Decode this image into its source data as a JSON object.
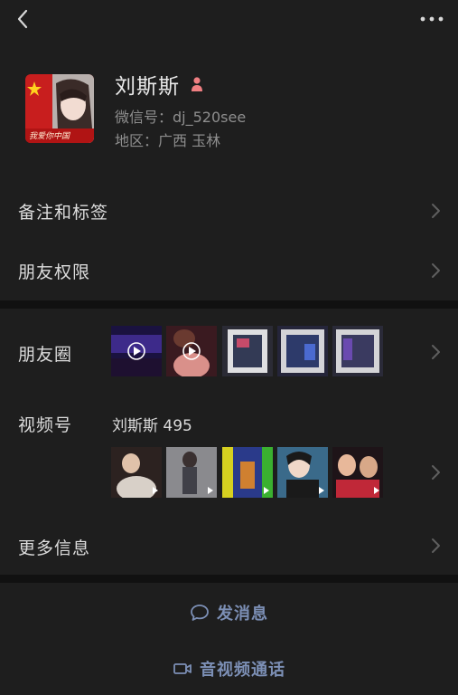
{
  "profile": {
    "name": "刘斯斯",
    "wechat_id": "微信号：dj_520see",
    "region": "地区：广西 玉林",
    "avatar_caption": "我爱你中国"
  },
  "menu": {
    "remark_tags": "备注和标签",
    "friend_permissions": "朋友权限",
    "moments": "朋友圈",
    "channels": "视频号",
    "channel_name": "刘斯斯 495",
    "more_info": "更多信息"
  },
  "actions": {
    "send_message": "发消息",
    "av_call": "音视频通话"
  },
  "icons": {
    "back": "chevron-left-icon",
    "more": "more-dots-icon",
    "gender": "female-icon",
    "chevron": "chevron-right-icon",
    "play": "play-icon",
    "message": "chat-bubble-icon",
    "video": "video-camera-icon"
  },
  "colors": {
    "background": "#111111",
    "panel": "#1e1e1e",
    "action_text": "#7c8fb5",
    "gender_icon": "#f07f82"
  }
}
